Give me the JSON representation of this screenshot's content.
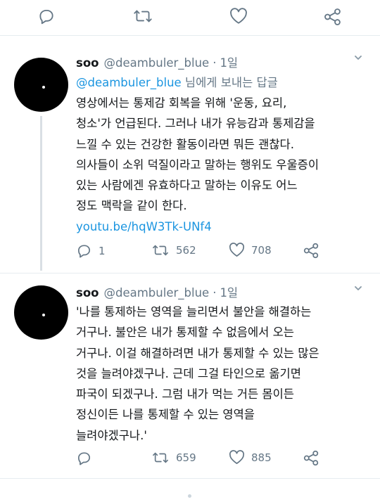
{
  "top_actions": {
    "label": "tweet actions"
  },
  "tweets": [
    {
      "name": "soo",
      "handle": "@deambuler_blue",
      "separator": "·",
      "time": "1일",
      "replying_mention": "@deambuler_blue",
      "replying_rest": " 님에게 보내는 답글",
      "body_lines": [
        "영상에서는 통제감 회복을 위해 '운동, 요리,",
        "청소'가 언급된다. 그러나 내가 유능감과 통제감을",
        "느낄 수 있는 건강한 활동이라면 뭐든 괜찮다.",
        "의사들이 소위 덕질이라고 말하는 행위도 우울증이",
        "있는 사람에겐 유효하다고 말하는 이유도 어느",
        "정도 맥락을 같이 한다."
      ],
      "link": "youtu.be/hqW3Tk-UNf4",
      "replies": "1",
      "retweets": "562",
      "likes": "708"
    },
    {
      "name": "soo",
      "handle": "@deambuler_blue",
      "separator": "·",
      "time": "1일",
      "body_lines": [
        "'나를 통제하는 영역을 늘리면서  불안을 해결하는",
        "거구나. 불안은 내가 통제할 수 없음에서 오는",
        "거구나. 이걸 해결하려면 내가 통제할 수 있는 많은",
        "것을 늘려야겠구나. 근데 그걸 타인으로 옮기면",
        "파국이 되겠구나. 그럼 내가 먹는 거든 몸이든",
        "정신이든 나를 통제할 수 있는 영역을",
        "늘려야겠구나.'"
      ],
      "retweets": "659",
      "likes": "885"
    }
  ],
  "colors": {
    "link": "#1b95e0",
    "secondary_text": "#657786",
    "divider": "#e6ecf0"
  }
}
